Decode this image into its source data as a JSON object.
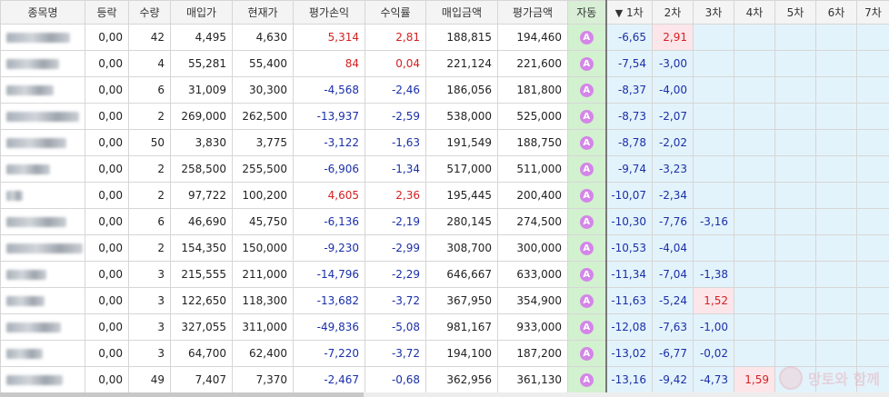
{
  "headers": {
    "name": "종목명",
    "change": "등락",
    "qty": "수량",
    "buy_price": "매입가",
    "cur_price": "현재가",
    "pnl": "평가손익",
    "ret": "수익률",
    "buy_amt": "매입금액",
    "eval_amt": "평가금액",
    "auto": "자동",
    "sort_arrow": "▼",
    "lvl1": "1차",
    "lvl2": "2차",
    "lvl3": "3차",
    "lvl4": "4차",
    "lvl5": "5차",
    "lvl6": "6차",
    "lvl7": "7차"
  },
  "auto_badge": "A",
  "colors": {
    "red": "#d42020",
    "blue": "#1a2fa8",
    "auto_bg": "#d2f1cf",
    "badge": "#d486e8",
    "level_bg": "#e3f3fb",
    "level_hit_bg": "#fce6ea"
  },
  "rows": [
    {
      "change": "0,00",
      "qty": "42",
      "buy_price": "4,495",
      "cur_price": "4,630",
      "pnl": "5,314",
      "ret": "2,81",
      "buy_amt": "188,815",
      "eval_amt": "194,460",
      "lvl": [
        "-6,65",
        "2,91",
        "",
        "",
        "",
        "",
        ""
      ]
    },
    {
      "change": "0,00",
      "qty": "4",
      "buy_price": "55,281",
      "cur_price": "55,400",
      "pnl": "84",
      "ret": "0,04",
      "buy_amt": "221,124",
      "eval_amt": "221,600",
      "lvl": [
        "-7,54",
        "-3,00",
        "",
        "",
        "",
        "",
        ""
      ]
    },
    {
      "change": "0,00",
      "qty": "6",
      "buy_price": "31,009",
      "cur_price": "30,300",
      "pnl": "-4,568",
      "ret": "-2,46",
      "buy_amt": "186,056",
      "eval_amt": "181,800",
      "lvl": [
        "-8,37",
        "-4,00",
        "",
        "",
        "",
        "",
        ""
      ]
    },
    {
      "change": "0,00",
      "qty": "2",
      "buy_price": "269,000",
      "cur_price": "262,500",
      "pnl": "-13,937",
      "ret": "-2,59",
      "buy_amt": "538,000",
      "eval_amt": "525,000",
      "lvl": [
        "-8,73",
        "-2,07",
        "",
        "",
        "",
        "",
        ""
      ]
    },
    {
      "change": "0,00",
      "qty": "50",
      "buy_price": "3,830",
      "cur_price": "3,775",
      "pnl": "-3,122",
      "ret": "-1,63",
      "buy_amt": "191,549",
      "eval_amt": "188,750",
      "lvl": [
        "-8,78",
        "-2,02",
        "",
        "",
        "",
        "",
        ""
      ]
    },
    {
      "change": "0,00",
      "qty": "2",
      "buy_price": "258,500",
      "cur_price": "255,500",
      "pnl": "-6,906",
      "ret": "-1,34",
      "buy_amt": "517,000",
      "eval_amt": "511,000",
      "lvl": [
        "-9,74",
        "-3,23",
        "",
        "",
        "",
        "",
        ""
      ]
    },
    {
      "change": "0,00",
      "qty": "2",
      "buy_price": "97,722",
      "cur_price": "100,200",
      "pnl": "4,605",
      "ret": "2,36",
      "buy_amt": "195,445",
      "eval_amt": "200,400",
      "lvl": [
        "-10,07",
        "-2,34",
        "",
        "",
        "",
        "",
        ""
      ]
    },
    {
      "change": "0,00",
      "qty": "6",
      "buy_price": "46,690",
      "cur_price": "45,750",
      "pnl": "-6,136",
      "ret": "-2,19",
      "buy_amt": "280,145",
      "eval_amt": "274,500",
      "lvl": [
        "-10,30",
        "-7,76",
        "-3,16",
        "",
        "",
        "",
        ""
      ]
    },
    {
      "change": "0,00",
      "qty": "2",
      "buy_price": "154,350",
      "cur_price": "150,000",
      "pnl": "-9,230",
      "ret": "-2,99",
      "buy_amt": "308,700",
      "eval_amt": "300,000",
      "lvl": [
        "-10,53",
        "-4,04",
        "",
        "",
        "",
        "",
        ""
      ]
    },
    {
      "change": "0,00",
      "qty": "3",
      "buy_price": "215,555",
      "cur_price": "211,000",
      "pnl": "-14,796",
      "ret": "-2,29",
      "buy_amt": "646,667",
      "eval_amt": "633,000",
      "lvl": [
        "-11,34",
        "-7,04",
        "-1,38",
        "",
        "",
        "",
        ""
      ]
    },
    {
      "change": "0,00",
      "qty": "3",
      "buy_price": "122,650",
      "cur_price": "118,300",
      "pnl": "-13,682",
      "ret": "-3,72",
      "buy_amt": "367,950",
      "eval_amt": "354,900",
      "lvl": [
        "-11,63",
        "-5,24",
        "1,52",
        "",
        "",
        "",
        ""
      ]
    },
    {
      "change": "0,00",
      "qty": "3",
      "buy_price": "327,055",
      "cur_price": "311,000",
      "pnl": "-49,836",
      "ret": "-5,08",
      "buy_amt": "981,167",
      "eval_amt": "933,000",
      "lvl": [
        "-12,08",
        "-7,63",
        "-1,00",
        "",
        "",
        "",
        ""
      ]
    },
    {
      "change": "0,00",
      "qty": "3",
      "buy_price": "64,700",
      "cur_price": "62,400",
      "pnl": "-7,220",
      "ret": "-3,72",
      "buy_amt": "194,100",
      "eval_amt": "187,200",
      "lvl": [
        "-13,02",
        "-6,77",
        "-0,02",
        "",
        "",
        "",
        ""
      ]
    },
    {
      "change": "0,00",
      "qty": "49",
      "buy_price": "7,407",
      "cur_price": "7,370",
      "pnl": "-2,467",
      "ret": "-0,68",
      "buy_amt": "362,956",
      "eval_amt": "361,130",
      "lvl": [
        "-13,16",
        "-9,42",
        "-4,73",
        "1,59",
        "",
        "",
        ""
      ]
    }
  ],
  "watermark": "망토와 함께"
}
